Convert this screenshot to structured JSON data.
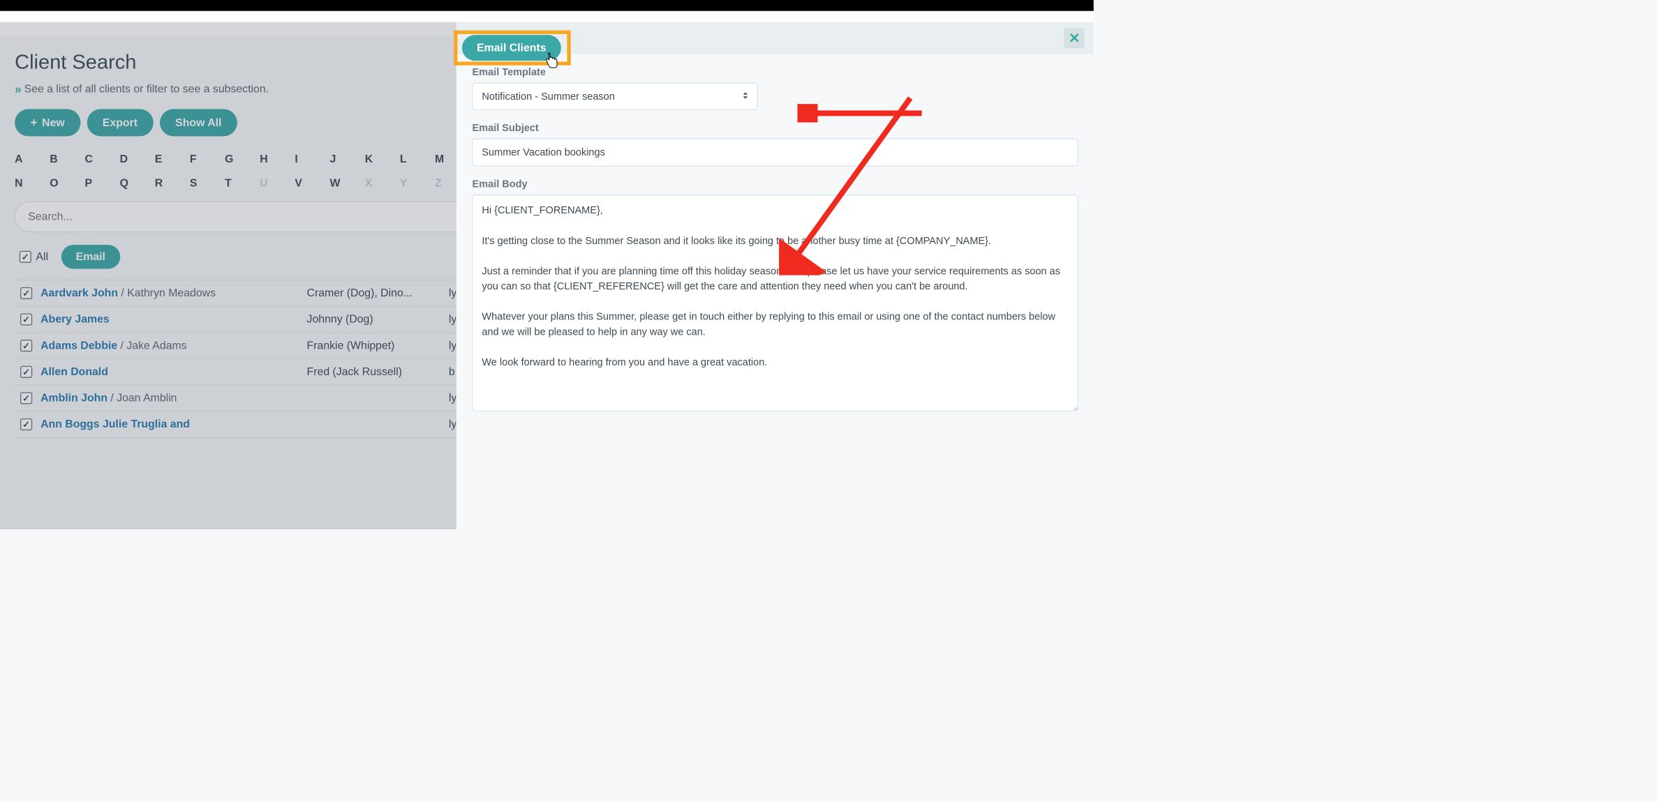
{
  "page": {
    "title": "Client Search",
    "subtitle": "See a list of all clients or filter to see a subsection."
  },
  "buttons": {
    "new": "New",
    "export": "Export",
    "show_all": "Show All"
  },
  "alpha_row1": [
    "A",
    "B",
    "C",
    "D",
    "E",
    "F",
    "G",
    "H",
    "I",
    "J",
    "K",
    "L",
    "M"
  ],
  "alpha_row2": [
    "N",
    "O",
    "P",
    "Q",
    "R",
    "S",
    "T",
    "U",
    "V",
    "W",
    "X",
    "Y",
    "Z"
  ],
  "alpha_dim": [
    "U",
    "X",
    "Y",
    "Z"
  ],
  "search": {
    "placeholder": "Search..."
  },
  "filters": {
    "all_label": "All",
    "email_label": "Email"
  },
  "clients": [
    {
      "name": "Aardvark John",
      "sub": " / Kathryn Meadows",
      "pet": "Cramer (Dog), Dino...",
      "email": "ly"
    },
    {
      "name": "Abery James",
      "sub": "",
      "pet": "Johnny (Dog)",
      "email": "ly"
    },
    {
      "name": "Adams Debbie",
      "sub": " / Jake Adams",
      "pet": "Frankie (Whippet)",
      "email": "ly"
    },
    {
      "name": "Allen Donald",
      "sub": "",
      "pet": "Fred (Jack Russell)",
      "email": "b"
    },
    {
      "name": "Amblin John",
      "sub": " / Joan Amblin",
      "pet": "",
      "email": "ly"
    },
    {
      "name": "Ann Boggs Julie Truglia and",
      "sub": "",
      "pet": "",
      "email": "ly"
    }
  ],
  "panel": {
    "email_clients_btn": "Email Clients",
    "template_label": "Email Template",
    "template_value": "Notification - Summer season",
    "subject_label": "Email Subject",
    "subject_value": "Summer Vacation bookings",
    "body_label": "Email Body",
    "body_value": "Hi {CLIENT_FORENAME},\n\nIt's getting close to the Summer Season and it looks like its going to be another busy time at {COMPANY_NAME}.\n\nJust a reminder that if you are planning time off this holiday season then please let us have your service requirements as soon as you can so that {CLIENT_REFERENCE} will get the care and attention they need when you can't be around.\n\nWhatever your plans this Summer, please get in touch either by replying to this email or using one of the contact numbers below and we will be pleased to help in any way we can.\n\nWe look forward to hearing from you and have a great vacation."
  }
}
